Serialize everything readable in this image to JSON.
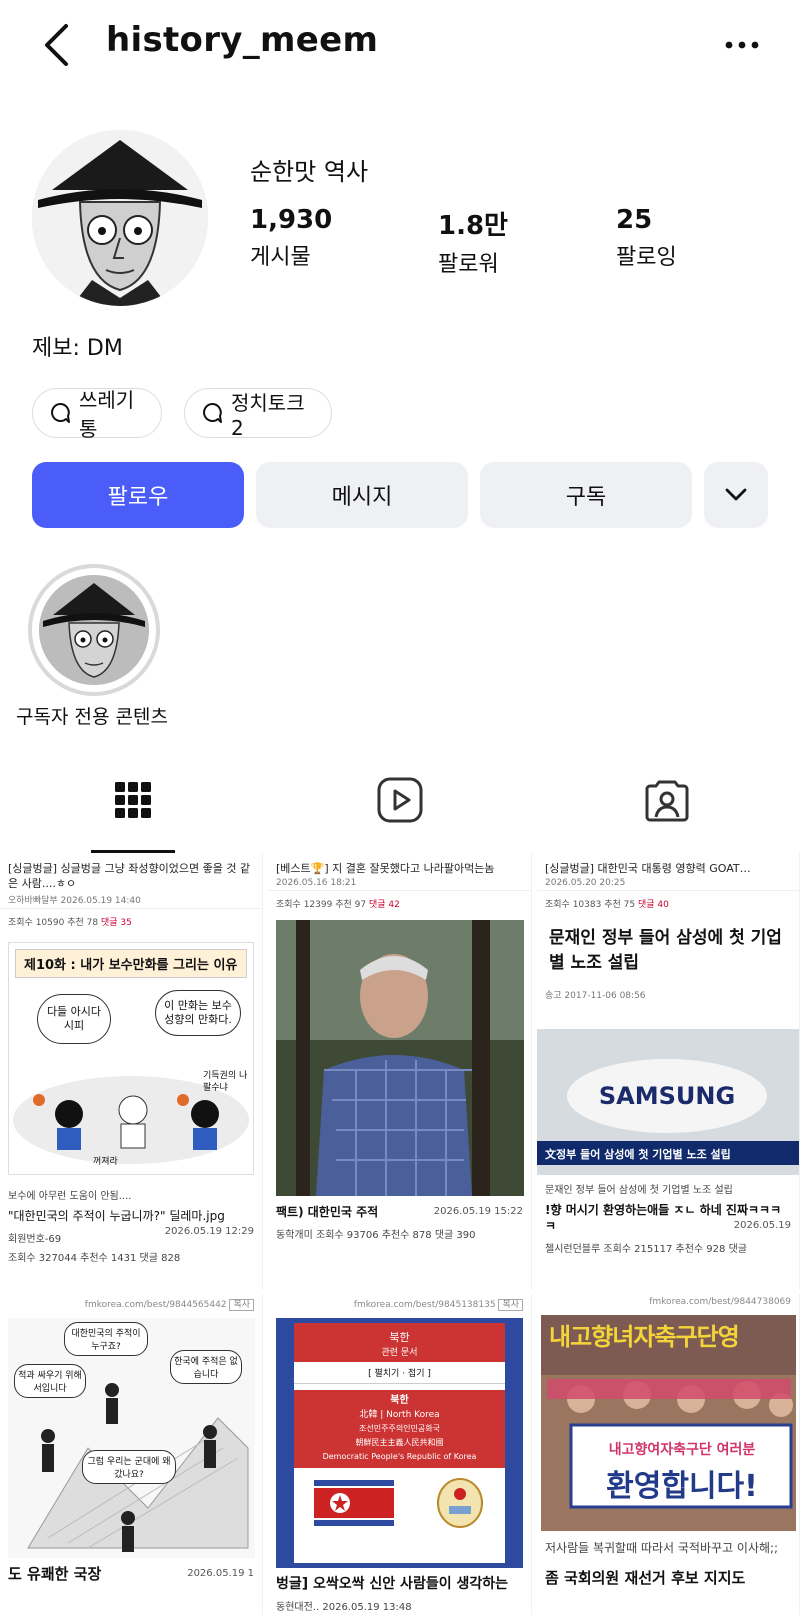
{
  "header": {
    "username": "history_meem"
  },
  "profile": {
    "display_name": "순한맛 역사",
    "stats": [
      {
        "num": "1,930",
        "label": "게시물"
      },
      {
        "num": "1.8만",
        "label": "팔로워"
      },
      {
        "num": "25",
        "label": "팔로잉"
      }
    ],
    "bio": "제보: DM",
    "chips": [
      "쓰레기통",
      "정치토크2"
    ]
  },
  "actions": {
    "follow": "팔로우",
    "message": "메시지",
    "subscribe": "구독"
  },
  "highlight": {
    "label": "구독자 전용 콘텐츠"
  },
  "posts": [
    {
      "head": "[싱글벙글] 싱글벙글 그냥 좌성향이었으면 좋을 것 같은 사람....ㅎㅇ",
      "meta": "오하바빠달부   2026.05.19 14:40",
      "stats": "조회수 10590   추천 78",
      "comments": "댓글 35",
      "panel_title": "제10화 : 내가 보수만화를 그리는 이유",
      "speech1": "다들 아시다시피",
      "speech2": "이 만화는 보수성향의 만화다.",
      "speech3": "기득권의 나팔수냐",
      "speech4": "꺼져라",
      "footer": "보수에 아무런 도움이 안됨....",
      "caption": "\"대한민국의 주적이 누굽니까?\" 딜레마.jpg",
      "caption_date": "2026.05.19 12:29",
      "author": "회원번호-69",
      "counts": "조회수 327044   추천수 1431   댓글 828"
    },
    {
      "head": "[베스트🏆] 지 결혼 잘못했다고 나라팔아먹는놈",
      "meta": "2026.05.16 18:21",
      "stats": "조회수 12399   추천 97",
      "comments": "댓글 42",
      "caption": "팩트) 대한민국 주적",
      "caption_date": "2026.05.19 15:22",
      "author": "동학개미",
      "counts": "조회수 93706   추천수 878   댓글 390"
    },
    {
      "head": "[싱글벙글] 대한민국 대통령 영향력 GOAT…",
      "meta": "2026.05.20 20:25",
      "stats": "조회수 10383   추천 75",
      "comments": "댓글 40",
      "big_title": "문재인 정부 들어 삼성에 첫 기업별 노조 설립",
      "date": "송고 2017-11-06 08:56",
      "news_logo": "SAMSUNG",
      "banner": "文정부 들어 삼성에 첫 기업별 노조 설립",
      "sub": "문재인 정부 들어 삼성에 첫 기업별 노조 설립",
      "caption": "!향 머시기 환영하는애들 ㅈㄴ 하네 진짜ㅋㅋㅋㅋ",
      "caption_date": "2026.05.19",
      "author": "첼시런던블루",
      "counts": "조회수 215117   추천수 928   댓글"
    },
    {
      "url": "fmkorea.com/best/9844565442",
      "copy": "복사",
      "b1": "대한민국의 주적이 누구죠?",
      "b2": "적과 싸우기 위해서입니다",
      "b3": "한국에 주적은 없습니다",
      "b4": "그럼 우리는 군대에 왜 갔나요?",
      "caption": "도 유쾌한 국장",
      "caption_date": "2026.05.19 1"
    },
    {
      "url": "fmkorea.com/best/9845138135",
      "copy": "복사",
      "nk": "북한",
      "nk_sub": "관련 문서",
      "fold": "[ 펼치기 · 접기 ]",
      "nk2": "북한",
      "nk2_sub": "北韓 | North Korea",
      "official1": "조선민주주의인민공화국",
      "official2": "朝鮮民主主義人民共和國",
      "official3": "Democratic People's Republic of Korea",
      "caption": "벙글] 오싹오싹 신안 사람들이 생각하는",
      "author": "동현대전..",
      "caption_date": "2026.05.19 13:48"
    },
    {
      "url": "fmkorea.com/best/9844738069",
      "sign1": "내고향여자축구단 여러분",
      "sign2": "환영합니다!",
      "banner_text": "내고향녀자축구단영",
      "footer": "저사람들 복귀할때 따라서 국적바꾸고 이사해;;",
      "caption": "좀 국회의원 재선거 후보 지지도"
    }
  ]
}
